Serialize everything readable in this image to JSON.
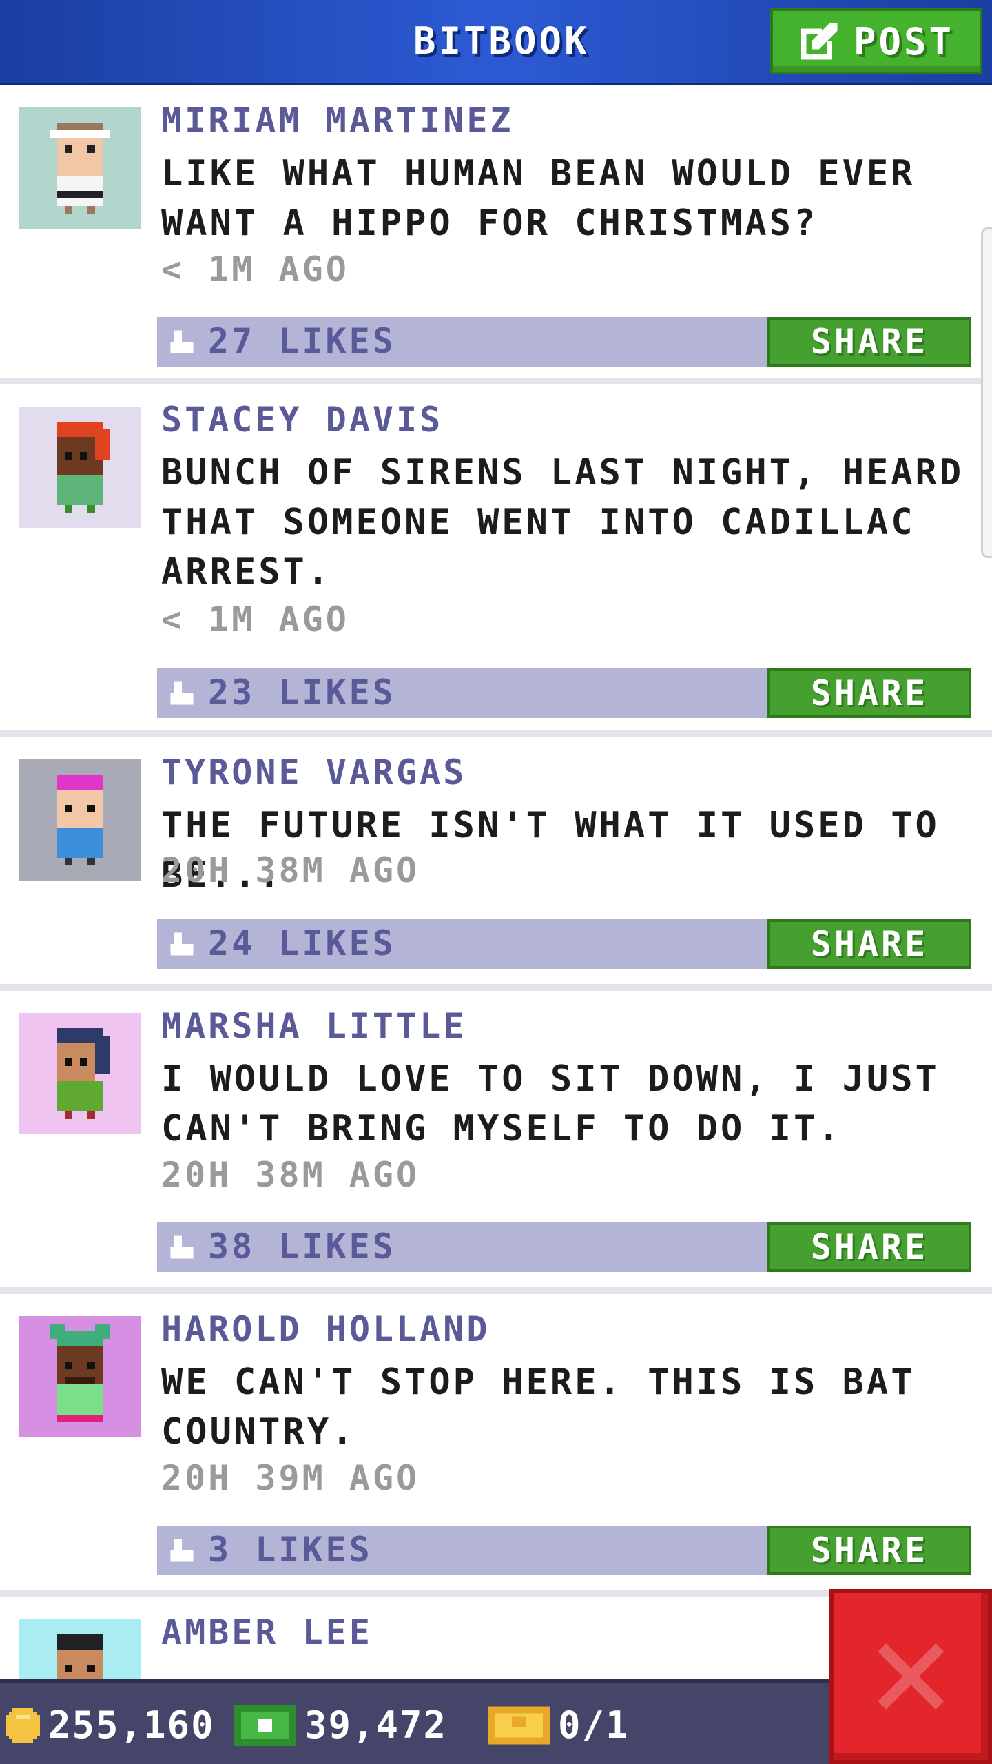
{
  "header": {
    "title": "BITBOOK",
    "post_label": "POST"
  },
  "posts": [
    {
      "author": "MIRIAM MARTINEZ",
      "message": "LIKE WHAT HUMAN BEAN WOULD EVER\nWANT A HIPPO FOR CHRISTMAS?",
      "time": "< 1M AGO",
      "likes": "27 LIKES",
      "share": "SHARE"
    },
    {
      "author": "STACEY DAVIS",
      "message": "BUNCH OF SIRENS LAST NIGHT, HEARD\nTHAT SOMEONE WENT INTO CADILLAC\nARREST.",
      "time": "< 1M AGO",
      "likes": "23 LIKES",
      "share": "SHARE"
    },
    {
      "author": "TYRONE VARGAS",
      "message": "THE FUTURE ISN'T WHAT IT USED TO BE...",
      "time": "20H 38M AGO",
      "likes": "24 LIKES",
      "share": "SHARE"
    },
    {
      "author": "MARSHA LITTLE",
      "message": "I WOULD LOVE TO SIT DOWN, I JUST\nCAN'T BRING MYSELF TO DO IT.",
      "time": "20H 38M AGO",
      "likes": "38 LIKES",
      "share": "SHARE"
    },
    {
      "author": "HAROLD HOLLAND",
      "message": "WE CAN'T STOP HERE. THIS IS BAT\nCOUNTRY.",
      "time": "20H 39M AGO",
      "likes": "3 LIKES",
      "share": "SHARE"
    },
    {
      "author": "AMBER LEE"
    }
  ],
  "status": {
    "coins": "255,160",
    "bux": "39,472",
    "tickets": "0/1"
  },
  "colors": {
    "header_blue": "#2d5ad4",
    "post_green": "#45b22e",
    "like_bar": "#b4b5d6",
    "author_purple": "#5a5a98",
    "close_red": "#e3262b"
  },
  "icons": {
    "post": "edit-square-icon",
    "like": "thumbs-up-icon",
    "coins": "coin-icon",
    "bux": "cash-icon",
    "tickets": "golden-ticket-icon",
    "close": "close-x-icon"
  }
}
